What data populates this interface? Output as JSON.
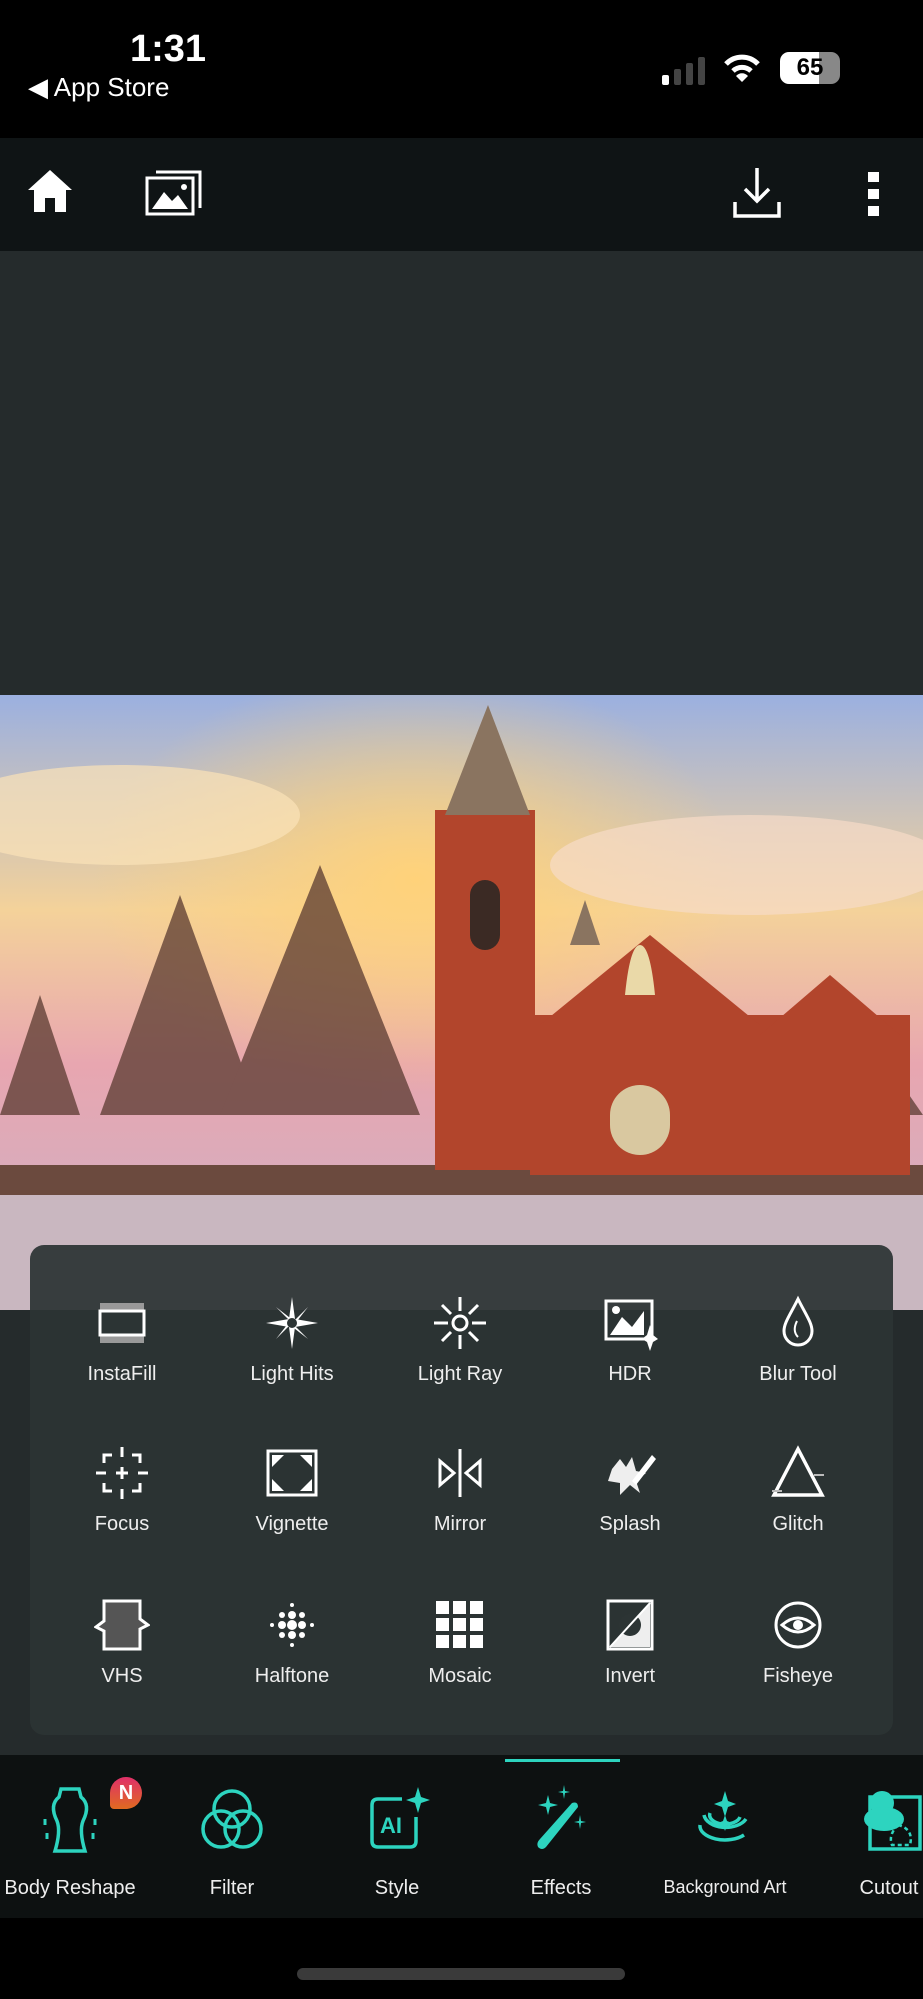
{
  "status_bar": {
    "time": "1:31",
    "back_label": "App Store",
    "battery": "65"
  },
  "toolbar": {
    "icons": [
      "home-icon",
      "gallery-icon",
      "download-icon",
      "more-icon"
    ]
  },
  "effects": [
    {
      "label": "InstaFill",
      "icon": "instafill-icon"
    },
    {
      "label": "Light Hits",
      "icon": "light-hits-icon"
    },
    {
      "label": "Light Ray",
      "icon": "light-ray-icon"
    },
    {
      "label": "HDR",
      "icon": "hdr-icon"
    },
    {
      "label": "Blur Tool",
      "icon": "blur-drop-icon"
    },
    {
      "label": "Focus",
      "icon": "focus-icon"
    },
    {
      "label": "Vignette",
      "icon": "vignette-icon"
    },
    {
      "label": "Mirror",
      "icon": "mirror-icon"
    },
    {
      "label": "Splash",
      "icon": "splash-icon"
    },
    {
      "label": "Glitch",
      "icon": "glitch-icon"
    },
    {
      "label": "VHS",
      "icon": "vhs-icon"
    },
    {
      "label": "Halftone",
      "icon": "halftone-icon"
    },
    {
      "label": "Mosaic",
      "icon": "mosaic-icon"
    },
    {
      "label": "Invert",
      "icon": "invert-icon"
    },
    {
      "label": "Fisheye",
      "icon": "fisheye-icon"
    }
  ],
  "nav": {
    "active": "Effects",
    "accent": "#2dd4bf",
    "badge": "N",
    "items": [
      {
        "label": "Body Reshape",
        "icon": "body-reshape-icon"
      },
      {
        "label": "Filter",
        "icon": "filter-icon"
      },
      {
        "label": "Style",
        "icon": "ai-style-icon"
      },
      {
        "label": "Effects",
        "icon": "magic-wand-icon"
      },
      {
        "label": "Background Art",
        "icon": "background-art-icon"
      },
      {
        "label": "Cutout",
        "icon": "cutout-icon"
      }
    ]
  }
}
